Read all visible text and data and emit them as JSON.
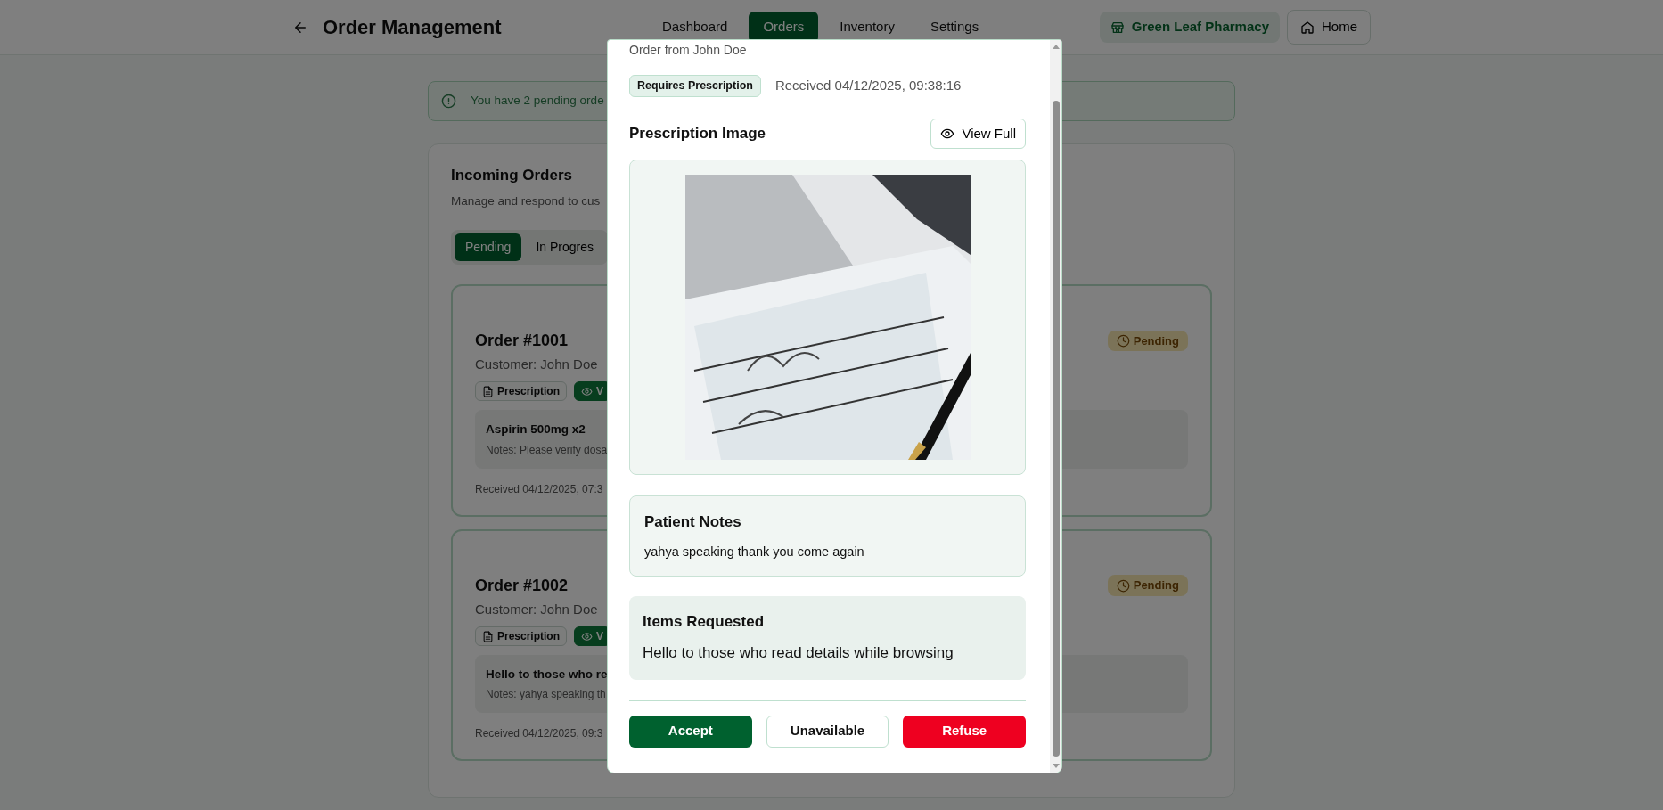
{
  "header": {
    "title": "Order Management",
    "nav": [
      {
        "label": "Dashboard",
        "selected": false
      },
      {
        "label": "Orders",
        "selected": true
      },
      {
        "label": "Inventory",
        "selected": false
      },
      {
        "label": "Settings",
        "selected": false
      }
    ],
    "pharmacy": "Green Leaf Pharmacy",
    "home": "Home"
  },
  "alert": "You have 2 pending orde",
  "orders_card": {
    "title": "Incoming Orders",
    "subtitle": "Manage and respond to cus",
    "tabs": [
      {
        "label": "Pending",
        "selected": true
      },
      {
        "label": "In Progres",
        "selected": false
      }
    ],
    "orders": [
      {
        "title": "Order #1001",
        "customer": "Customer: John Doe",
        "tags": [
          {
            "label": "Prescription",
            "kind": "outline"
          },
          {
            "label": "V",
            "kind": "filled"
          }
        ],
        "status": "Pending",
        "item": "Aspirin 500mg x2",
        "notes": "Notes: Please verify dosa",
        "received": "Received 04/12/2025, 07:3"
      },
      {
        "title": "Order #1002",
        "customer": "Customer: John Doe",
        "tags": [
          {
            "label": "Prescription",
            "kind": "outline"
          },
          {
            "label": "V",
            "kind": "filled"
          }
        ],
        "status": "Pending",
        "item": "Hello to those who re",
        "notes": "Notes: yahya speaking th",
        "received": "Received 04/12/2025, 09:3"
      }
    ]
  },
  "modal": {
    "title": "Order from John Doe",
    "badge": "Requires Prescription",
    "received": "Received 04/12/2025, 09:38:16",
    "image_heading": "Prescription Image",
    "view_full": "View Full",
    "notes_title": "Patient Notes",
    "notes": "yahya speaking thank you come again",
    "items_title": "Items Requested",
    "items": "Hello to those who read details while browsing",
    "actions": [
      {
        "label": "Accept",
        "kind": "primary"
      },
      {
        "label": "Unavailable",
        "kind": "outline"
      },
      {
        "label": "Refuse",
        "kind": "danger"
      }
    ]
  }
}
